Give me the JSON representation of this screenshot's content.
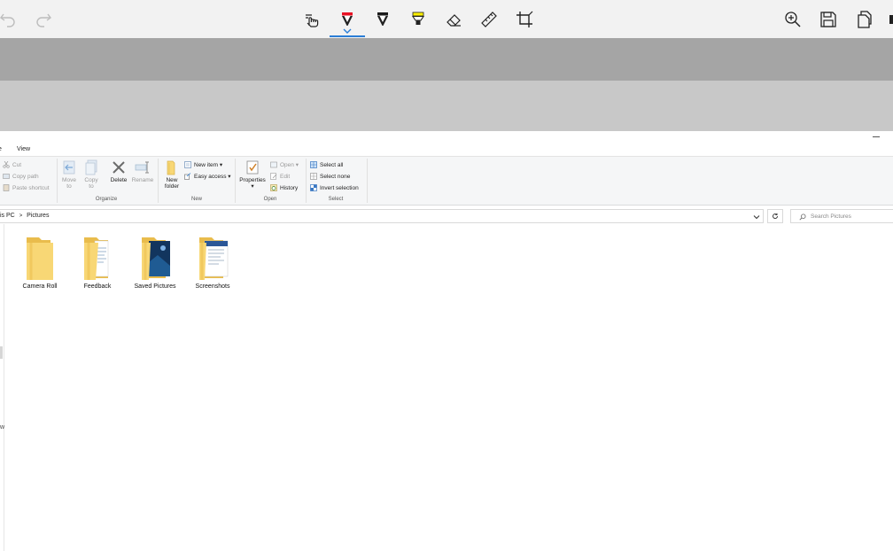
{
  "toolbar": {
    "tools": [
      {
        "name": "undo-icon"
      },
      {
        "name": "redo-icon"
      },
      {
        "name": "touch-writing-icon"
      },
      {
        "name": "ballpoint-pen-icon",
        "color": "#e81123",
        "active": true
      },
      {
        "name": "pencil-icon",
        "color": "#1a1a1a"
      },
      {
        "name": "highlighter-icon",
        "color": "#fff100"
      },
      {
        "name": "eraser-icon"
      },
      {
        "name": "ruler-icon"
      },
      {
        "name": "crop-icon"
      },
      {
        "name": "zoom-icon"
      },
      {
        "name": "save-icon"
      },
      {
        "name": "copy-icon"
      }
    ],
    "accent_color": "#2b7ed6"
  },
  "ribbon": {
    "tab_partial": "e",
    "tab_view": "View",
    "clipboard": {
      "cut": "Cut",
      "copy_path": "Copy path",
      "paste_shortcut": "Paste shortcut"
    },
    "organize": {
      "move_to_l1": "Move",
      "move_to_l2": "to",
      "copy_to_l1": "Copy",
      "copy_to_l2": "to",
      "delete": "Delete",
      "rename": "Rename",
      "label": "Organize"
    },
    "new": {
      "new_folder_l1": "New",
      "new_folder_l2": "folder",
      "new_item": "New item",
      "easy_access": "Easy access",
      "label": "New"
    },
    "open": {
      "properties": "Properties",
      "open": "Open",
      "edit": "Edit",
      "history": "History",
      "label": "Open"
    },
    "select": {
      "select_all": "Select all",
      "select_none": "Select none",
      "invert_selection": "Invert selection",
      "label": "Select"
    }
  },
  "address": {
    "crumb_this_pc": "is PC",
    "separator": ">",
    "crumb_pictures": "Pictures"
  },
  "search": {
    "placeholder": "Search Pictures"
  },
  "folders": [
    {
      "label": "Camera Roll",
      "preview": "none"
    },
    {
      "label": "Feedback",
      "preview": "documents"
    },
    {
      "label": "Saved Pictures",
      "preview": "photo"
    },
    {
      "label": "Screenshots",
      "preview": "screenshot"
    }
  ],
  "edge_glyph": "w"
}
